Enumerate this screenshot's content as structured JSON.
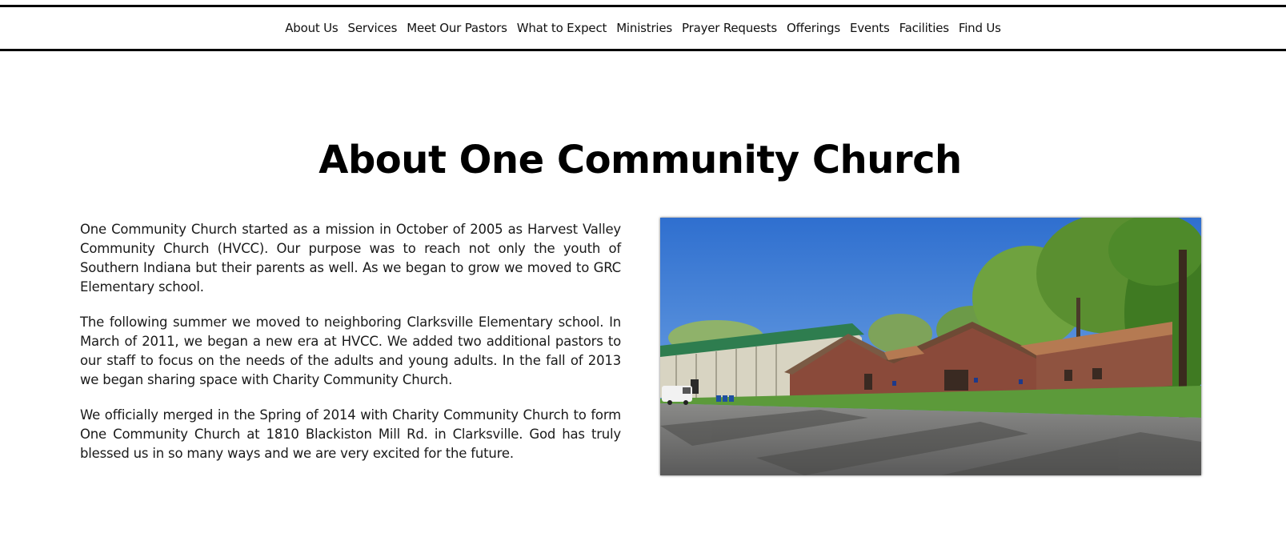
{
  "nav": {
    "items": [
      "About Us",
      "Services",
      "Meet Our Pastors",
      "What to Expect",
      "Ministries",
      "Prayer Requests",
      "Offerings",
      "Events",
      "Facilities",
      "Find Us"
    ]
  },
  "main": {
    "title": "About One Community Church",
    "paragraphs": [
      "One Community Church started as a mission in October of 2005 as Harvest Valley Community Church (HVCC). Our purpose was to reach not only the youth of Southern Indiana but their parents as well. As we began to grow we moved to GRC Elementary school.",
      "The following summer we moved to neighboring Clarksville Elementary school. In March of 2011, we began a new era at HVCC. We added two additional pastors to our staff to focus on the needs of the adults and young adults. In the fall of 2013 we began sharing space with Charity Community Church.",
      "We officially merged in the Spring of 2014 with Charity Community Church to form One Community Church at 1810 Blackiston Mill Rd. in Clarksville. God has truly blessed us in so many ways and we are very excited for the future."
    ],
    "photo": {
      "subject": "church-building-photo"
    }
  },
  "colors": {
    "nav_border": "#000000",
    "text": "#111111",
    "sky": "#3a78d0",
    "roof_green": "#2e7d4f",
    "brick": "#8a4a3a",
    "grass": "#5c9a3a",
    "asphalt": "#6d6d6d"
  }
}
